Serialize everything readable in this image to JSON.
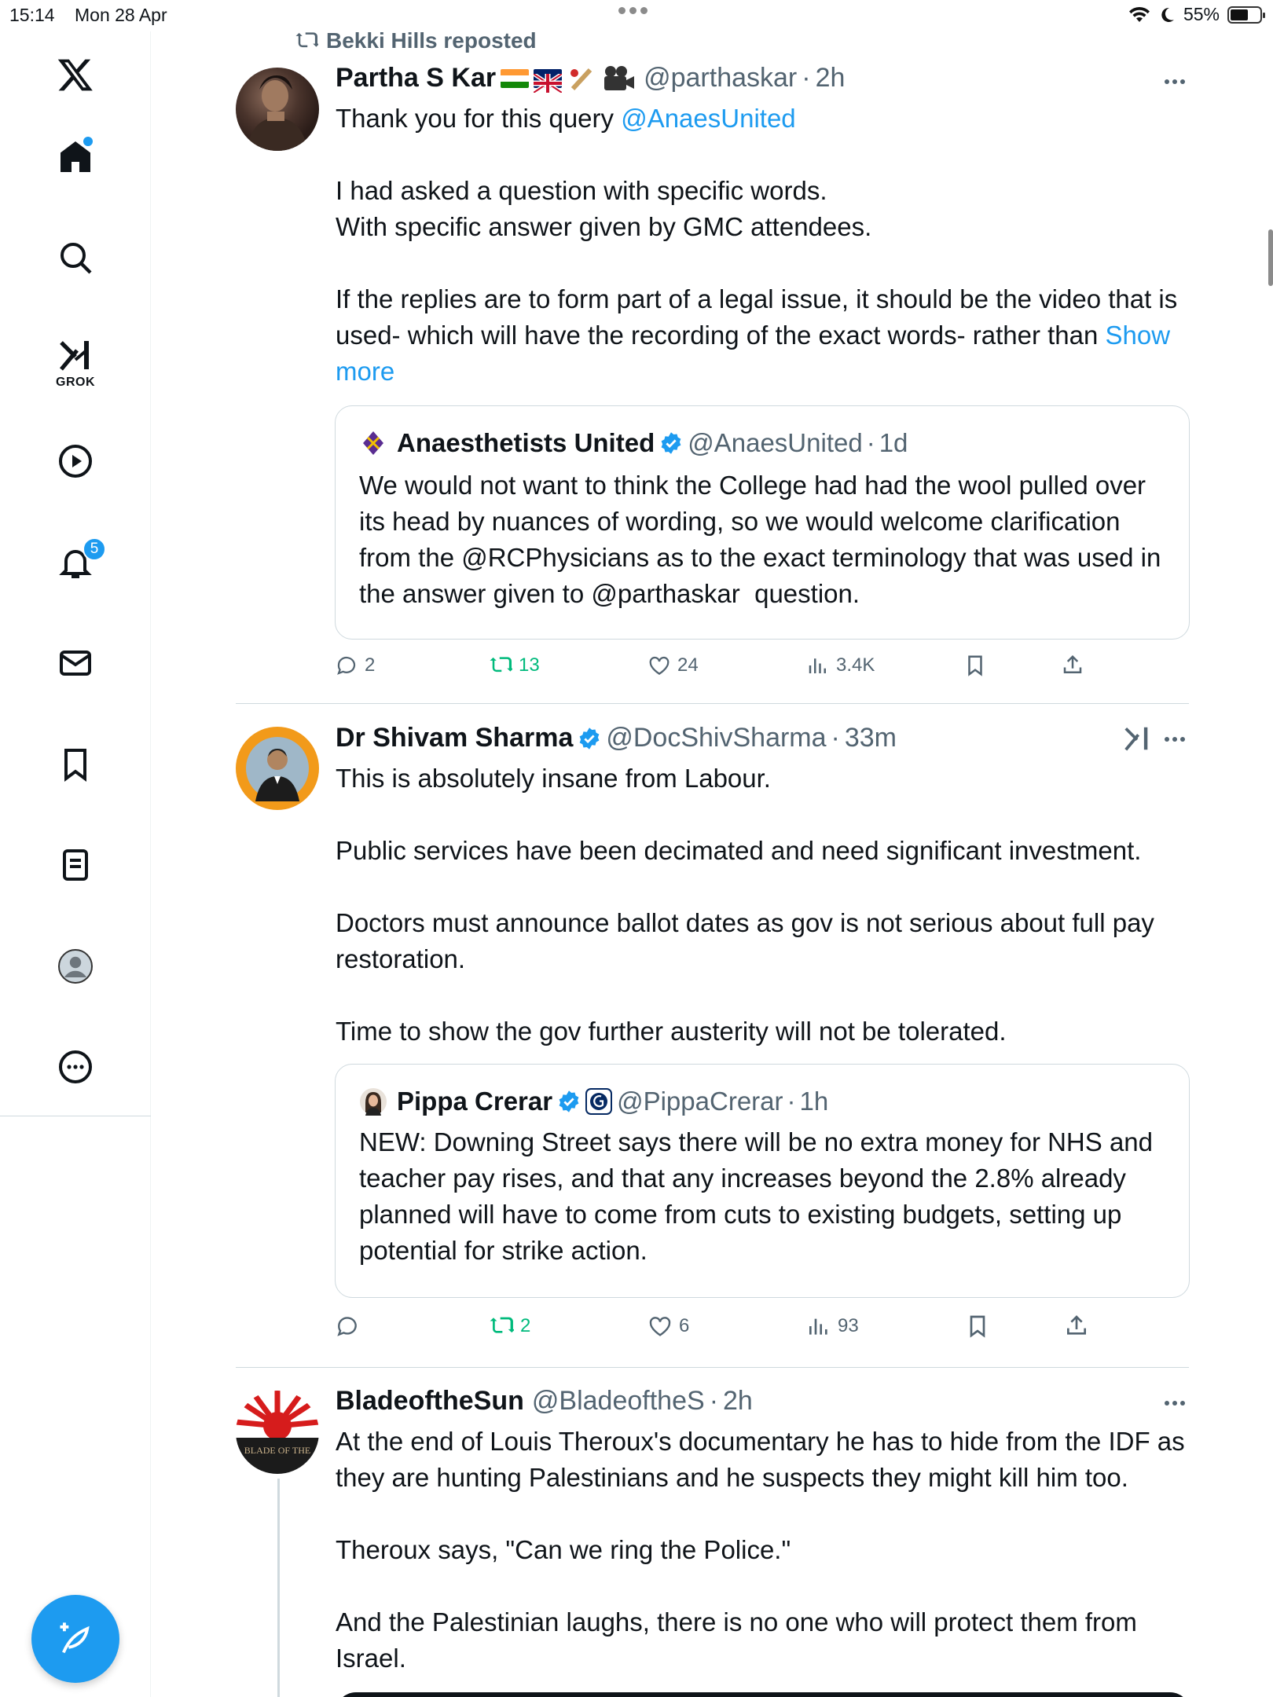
{
  "status_bar": {
    "time": "15:14",
    "date": "Mon 28 Apr",
    "battery": "55%"
  },
  "sidebar": {
    "grok_label": "GROK",
    "notification_count": "5",
    "accent": "#1d9bf0"
  },
  "feed": {
    "tweet1": {
      "repost_label": "Bekki Hills reposted",
      "author_name": "Partha S Kar",
      "handle": "@parthaskar",
      "time": "2h",
      "text_intro": "Thank you for this query ",
      "mention": "@AnaesUnited",
      "body": "I had asked a question with specific words.\nWith specific answer given by GMC attendees.\n\nIf the replies are to form part of a legal issue, it should be the video that is used- which will have the recording of the exact words- rather than ",
      "show_more": "Show more",
      "quote": {
        "author_name": "Anaesthetists United",
        "handle": "@AnaesUnited",
        "time": "1d",
        "text": "We would not want to think the College had had the wool pulled over its head by nuances of wording, so we would welcome clarification from the @RCPhysicians as to the exact terminology that was used in the answer given to @parthaskar  question."
      },
      "replies": "2",
      "reposts": "13",
      "likes": "24",
      "views": "3.4K"
    },
    "tweet2": {
      "author_name": "Dr Shivam Sharma",
      "handle": "@DocShivSharma",
      "time": "33m",
      "text": "This is absolutely insane from Labour.\n\nPublic services have been decimated and need significant investment.\n\nDoctors must announce ballot dates as gov is not serious about full pay restoration.\n\nTime to show the gov further austerity will not be tolerated.",
      "quote": {
        "author_name": "Pippa Crerar",
        "handle": "@PippaCrerar",
        "time": "1h",
        "text": "NEW: Downing Street says there will be no extra money for NHS and teacher pay rises, and that any increases beyond the 2.8% already planned will have to come from cuts to existing budgets, setting up potential for strike action."
      },
      "replies": "",
      "reposts": "2",
      "likes": "6",
      "views": "93"
    },
    "tweet3": {
      "author_name": "BladeoftheSun",
      "handle": "@BladeoftheS",
      "time": "2h",
      "text": "At the end of Louis Theroux's documentary he has to hide from the IDF as they are hunting Palestinians and he suspects they might kill him too.\n\nTheroux says, \"Can we ring the Police.\"\n\nAnd the Palestinian laughs, there is no one who will protect them from Israel.",
      "avatar_text": "BLADE OF THE"
    }
  }
}
